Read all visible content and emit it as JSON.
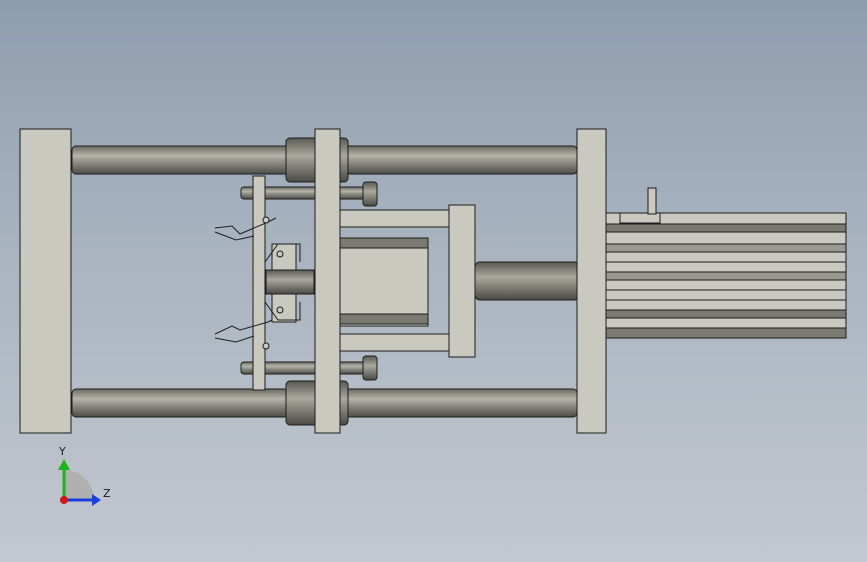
{
  "triad": {
    "y_label": "Y",
    "z_label": "Z",
    "y_color": "#1db31d",
    "z_color": "#1a3fe0",
    "x_color": "#d01818"
  },
  "colors": {
    "part_fill": "#c9c9bf",
    "part_dark": "#7a7a70",
    "edge": "#1c1c1c",
    "rod_light": "#9a9a90",
    "rod_dark": "#55554e"
  }
}
